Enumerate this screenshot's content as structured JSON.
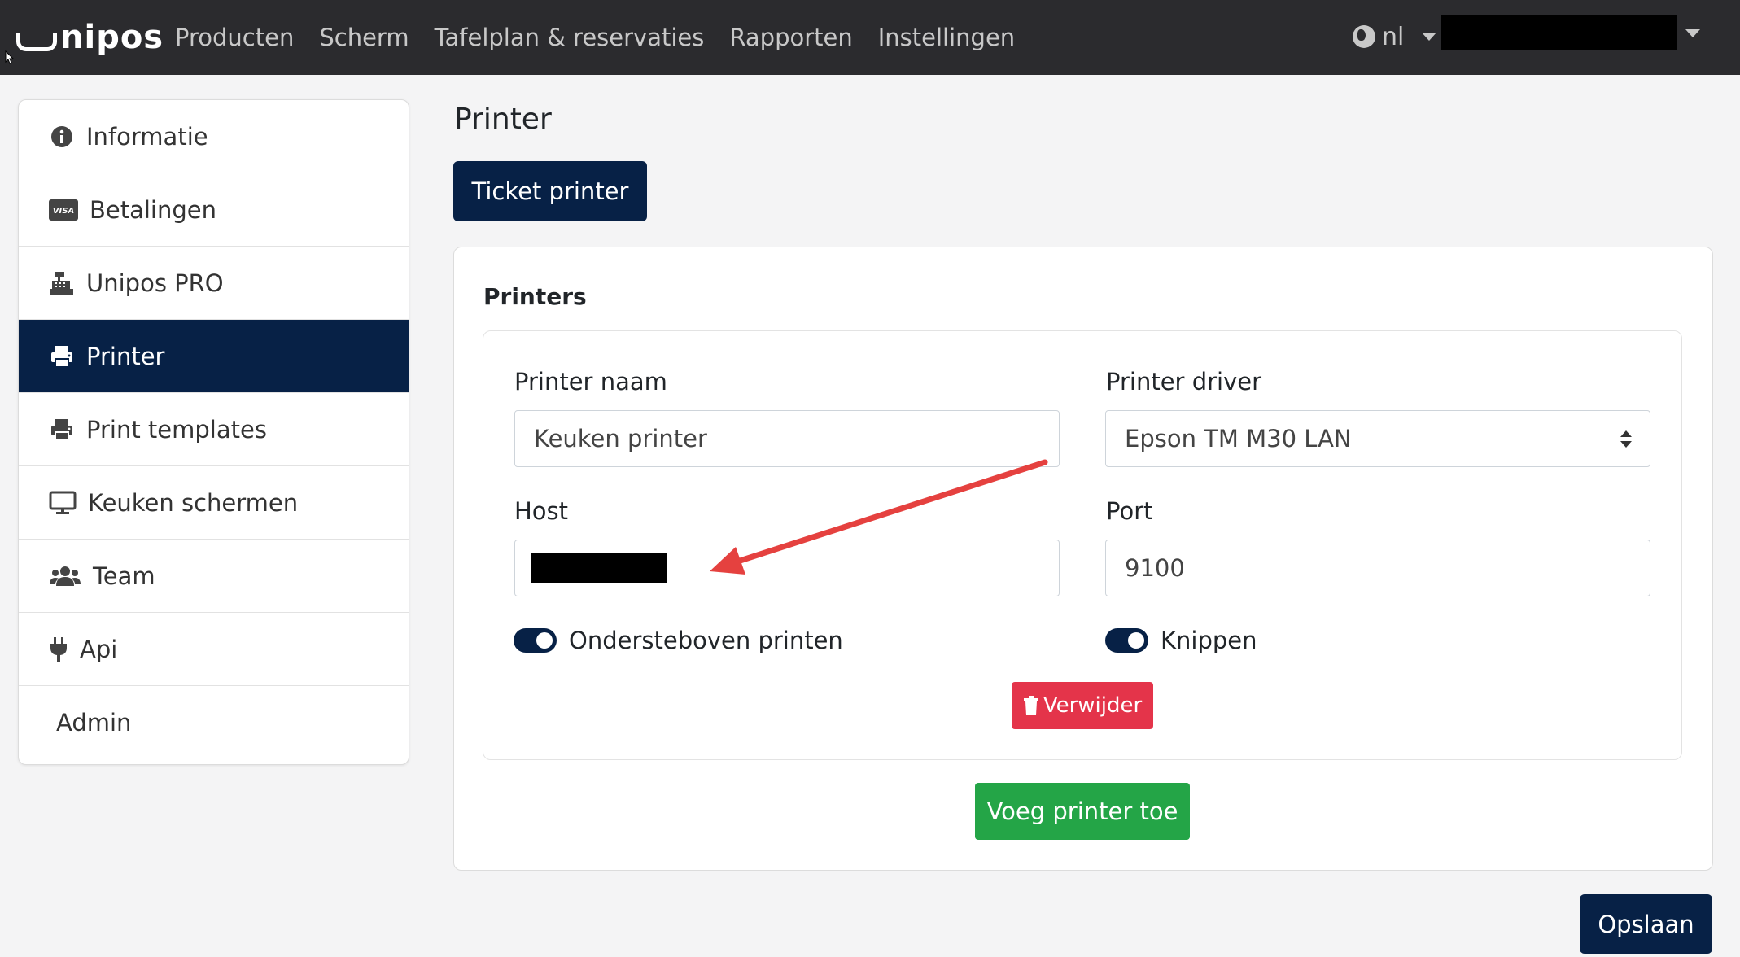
{
  "navbar": {
    "logo": "nipos",
    "links": [
      "Producten",
      "Scherm",
      "Tafelplan & reservaties",
      "Rapporten",
      "Instellingen"
    ],
    "language": "nl"
  },
  "sidebar": {
    "items": [
      {
        "label": "Informatie",
        "icon": "info-circle-icon"
      },
      {
        "label": "Betalingen",
        "icon": "visa-card-icon"
      },
      {
        "label": "Unipos PRO",
        "icon": "cash-register-icon"
      },
      {
        "label": "Printer",
        "icon": "printer-icon",
        "active": true
      },
      {
        "label": "Print templates",
        "icon": "printer-icon"
      },
      {
        "label": "Keuken schermen",
        "icon": "monitor-icon"
      },
      {
        "label": "Team",
        "icon": "users-icon"
      },
      {
        "label": "Api",
        "icon": "plug-icon"
      },
      {
        "label": "Admin",
        "icon": ""
      }
    ]
  },
  "main": {
    "title": "Printer",
    "tab_button": "Ticket printer",
    "card_title": "Printers",
    "form": {
      "name_label": "Printer naam",
      "name_value": "Keuken printer",
      "driver_label": "Printer driver",
      "driver_value": "Epson TM M30 LAN",
      "host_label": "Host",
      "port_label": "Port",
      "port_value": "9100",
      "toggle_upside_down": "Ondersteboven printen",
      "toggle_cut": "Knippen",
      "delete_button": "Verwijder"
    },
    "add_printer_button": "Voeg printer toe",
    "save_button": "Opslaan"
  },
  "colors": {
    "navbar": "#2b2b2e",
    "primary": "#072146",
    "danger": "#e4344a",
    "success": "#24a547",
    "annotation_arrow": "#e5413f"
  }
}
